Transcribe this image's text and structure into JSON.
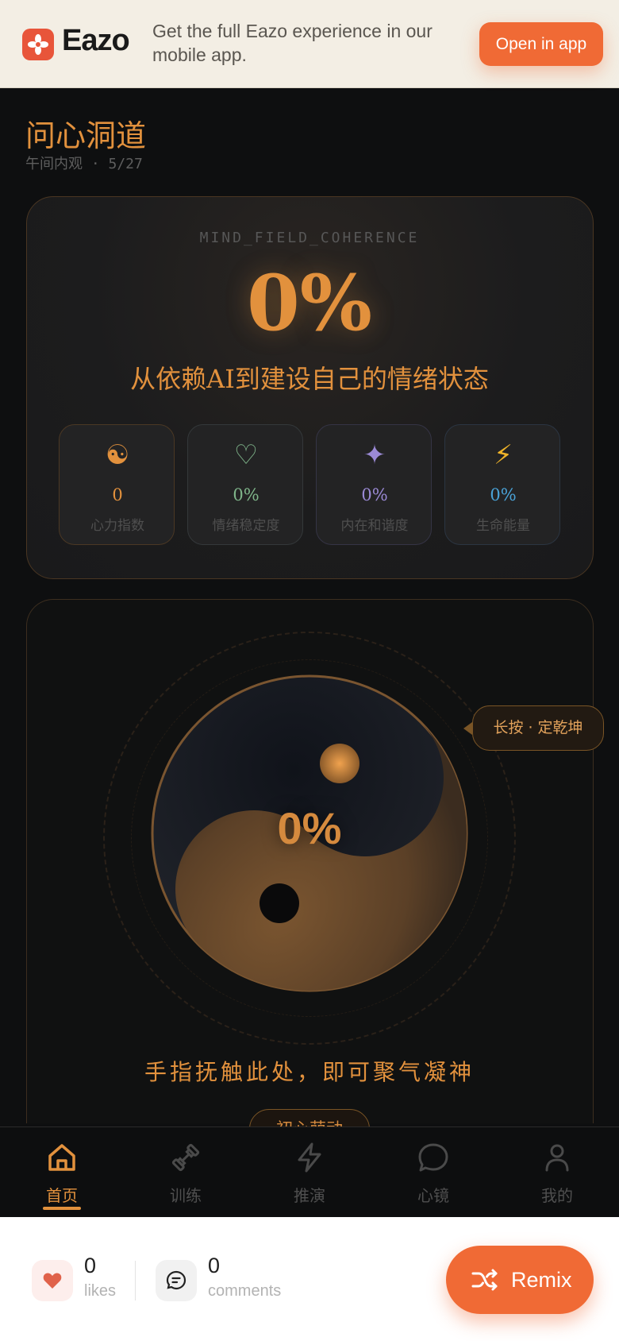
{
  "banner": {
    "brand": "Eazo",
    "promo_text": "Get the full Eazo experience in our mobile app.",
    "open_label": "Open in app",
    "accent": "#f06a35"
  },
  "header": {
    "title": "问心洞道",
    "subtitle": "午间内观 · 5/27"
  },
  "coherence_card": {
    "label": "MIND_FIELD_COHERENCE",
    "value": "0%",
    "headline": "从依赖AI到建设自己的情绪状态",
    "stats": [
      {
        "icon": "☯",
        "value": "0",
        "label": "心力指数",
        "color": "#e2913d",
        "icon_name": "yin-yang-icon"
      },
      {
        "icon": "♡",
        "value": "0%",
        "label": "情绪稳定度",
        "color": "#7fb58a",
        "icon_name": "heart-icon"
      },
      {
        "icon": "✦",
        "value": "0%",
        "label": "内在和谐度",
        "color": "#9b8ad6",
        "icon_name": "sparkle-icon"
      },
      {
        "icon": "⚡",
        "value": "0%",
        "label": "生命能量",
        "color": "#4aa3d8",
        "icon_name": "lightning-icon"
      }
    ]
  },
  "yinyang_card": {
    "value": "0%",
    "tooltip": "长按 · 定乾坤",
    "touch_text": "手指抚触此处，即可聚气凝神",
    "pill_label": "初心萌动"
  },
  "nav": {
    "items": [
      {
        "label": "首页",
        "icon": "home-icon",
        "active": true
      },
      {
        "label": "训练",
        "icon": "dumbbell-icon",
        "active": false
      },
      {
        "label": "推演",
        "icon": "lightning-icon",
        "active": false
      },
      {
        "label": "心镜",
        "icon": "chat-bubble-icon",
        "active": false
      },
      {
        "label": "我的",
        "icon": "user-icon",
        "active": false
      }
    ]
  },
  "footer": {
    "likes_count": "0",
    "likes_label": "likes",
    "comments_count": "0",
    "comments_label": "comments",
    "remix_label": "Remix"
  }
}
